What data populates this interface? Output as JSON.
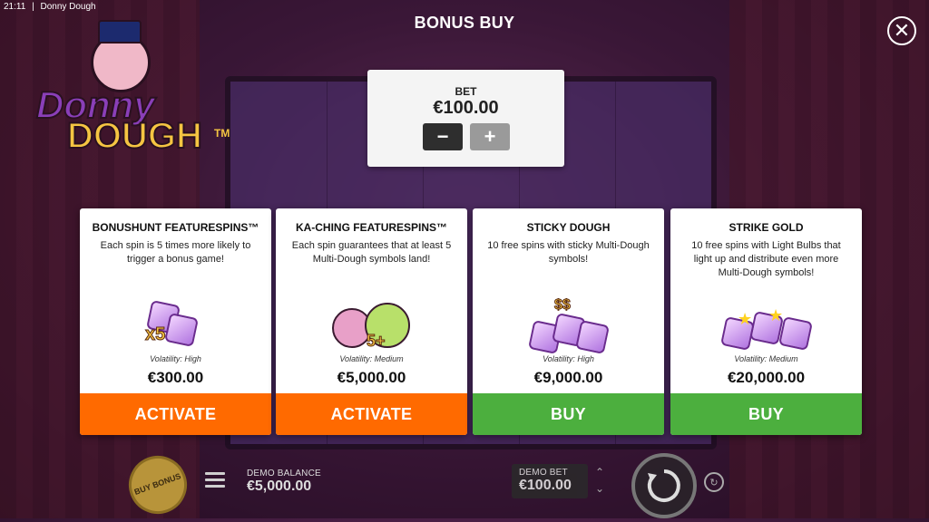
{
  "window": {
    "time": "21:11",
    "separator": "|",
    "app_title": "Donny Dough"
  },
  "logo": {
    "line1": "Donny",
    "line2": "DOUGH",
    "tm": "TM"
  },
  "heading": "BONUS BUY",
  "close_icon": "close-icon",
  "bet": {
    "label": "BET",
    "value": "€100.00",
    "minus": "−",
    "plus": "+"
  },
  "cards": [
    {
      "title": "BONUSHUNT FEATURESPINS™",
      "description": "Each spin is 5 times more likely to trigger a bonus game!",
      "art_text": "x5",
      "volatility": "Volatility: High",
      "price": "€300.00",
      "button": "ACTIVATE",
      "button_color": "#ff6a00"
    },
    {
      "title": "KA-CHING FEATURESPINS™",
      "description": "Each spin guarantees that at least 5 Multi-Dough symbols land!",
      "art_text": "5+",
      "volatility": "Volatility: Medium",
      "price": "€5,000.00",
      "button": "ACTIVATE",
      "button_color": "#ff6a00"
    },
    {
      "title": "STICKY DOUGH",
      "description": "10 free spins with sticky Multi-Dough symbols!",
      "art_text": "$$",
      "volatility": "Volatility: High",
      "price": "€9,000.00",
      "button": "BUY",
      "button_color": "#4caf3e"
    },
    {
      "title": "STRIKE GOLD",
      "description": "10 free spins with Light Bulbs that light up and distribute even more Multi-Dough symbols!",
      "art_text": "",
      "volatility": "Volatility: Medium",
      "price": "€20,000.00",
      "button": "BUY",
      "button_color": "#4caf3e"
    }
  ],
  "bottom": {
    "buy_bonus": "BUY BONUS",
    "demo_balance_label": "DEMO BALANCE",
    "demo_balance_value": "€5,000.00",
    "demo_bet_label": "DEMO BET",
    "demo_bet_value": "€100.00",
    "arrow_up": "⌃",
    "arrow_down": "⌄",
    "autoplay_glyph": "↻"
  }
}
